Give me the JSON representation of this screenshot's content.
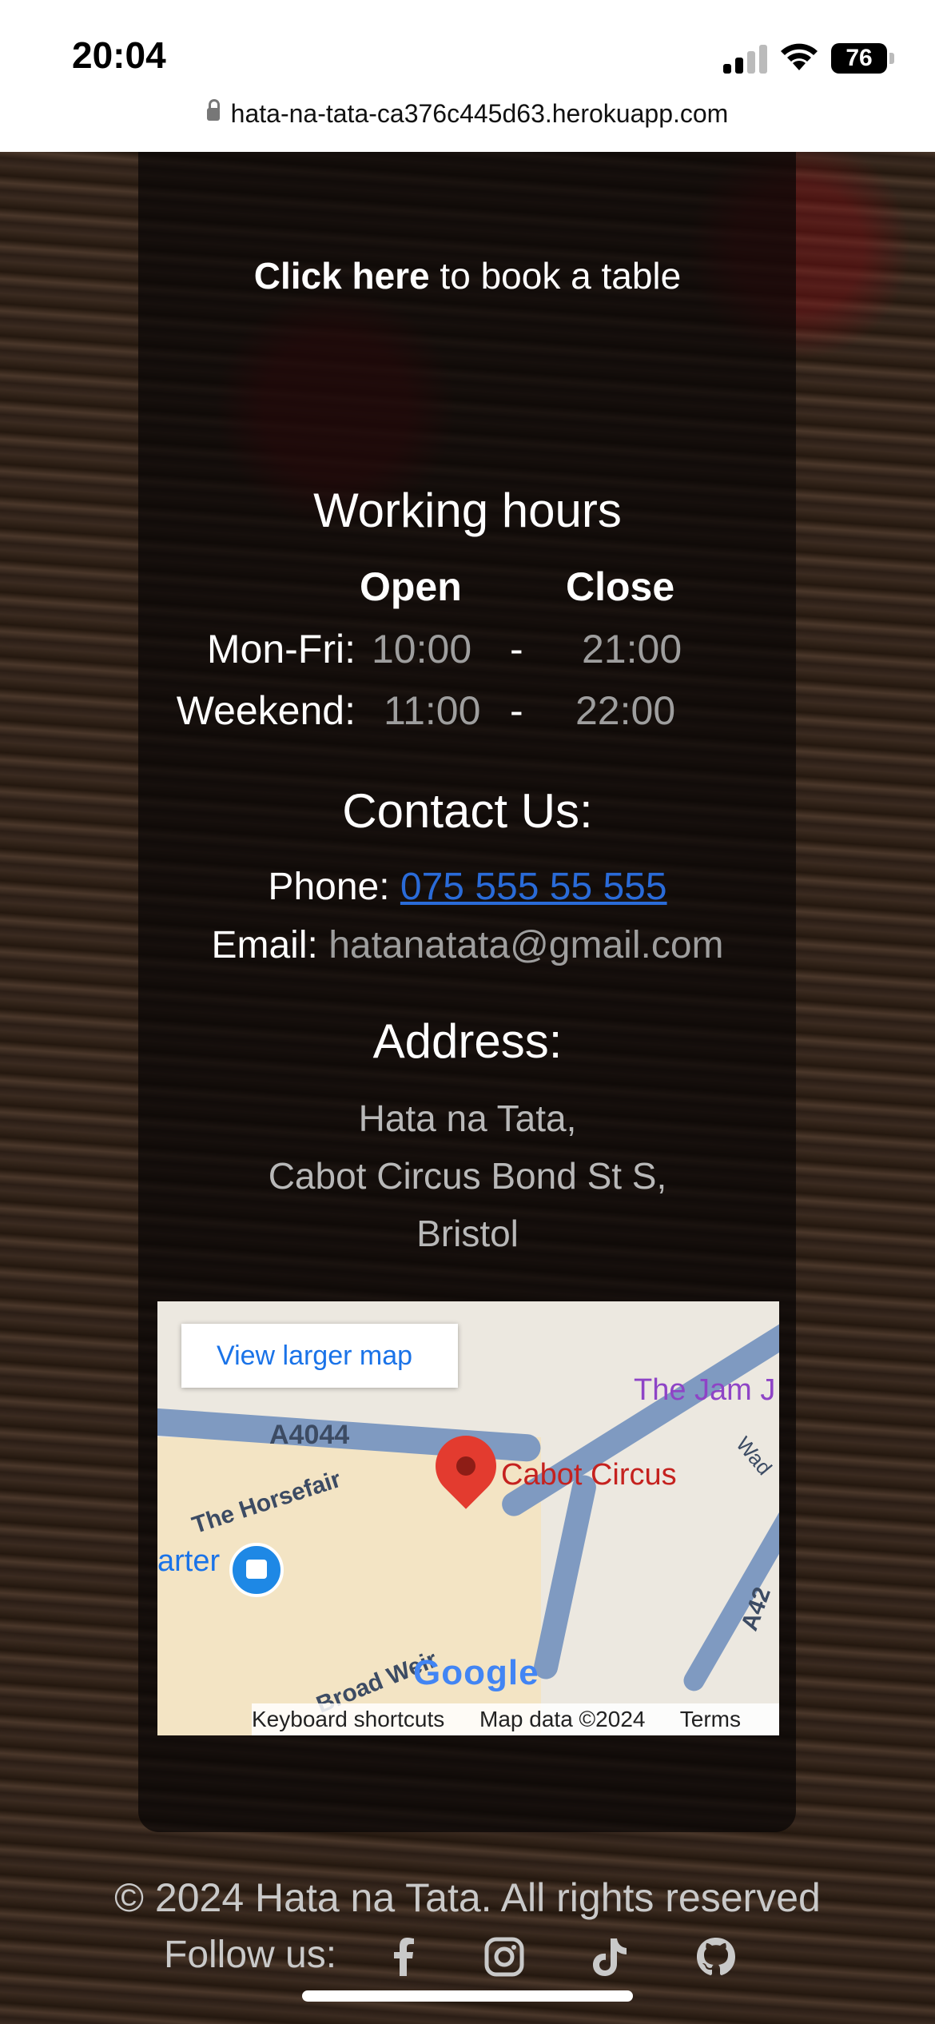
{
  "status": {
    "time": "20:04",
    "battery": "76",
    "url": "hata-na-tata-ca376c445d63.herokuapp.com"
  },
  "booking": {
    "link_text": "Click here",
    "rest_text": " to book a table"
  },
  "hours": {
    "title": "Working hours",
    "open_label": "Open",
    "close_label": "Close",
    "rows": [
      {
        "day": "Mon-Fri:",
        "open": "10:00",
        "dash": "-",
        "close": "21:00"
      },
      {
        "day": "Weekend:",
        "open": "11:00",
        "dash": "-",
        "close": "22:00"
      }
    ]
  },
  "contact": {
    "title": "Contact Us:",
    "phone_label": "Phone:",
    "phone": "075 555 55 555",
    "email_label": "Email:",
    "email": "hatanatata@gmail.com"
  },
  "address": {
    "title": "Address:",
    "lines": [
      "Hata na Tata,",
      "Cabot Circus Bond St S,",
      "Bristol"
    ]
  },
  "map": {
    "button": "View larger map",
    "labels": {
      "road_a4044": "A4044",
      "horsefair": "The Horsefair",
      "place": "Cabot Circus",
      "jam": "The Jam J",
      "quarter": "arter",
      "broad_weir": "Broad Weir",
      "a42": "A42",
      "wad": "Wad"
    },
    "brand": "Google",
    "footer": {
      "shortcuts": "Keyboard shortcuts",
      "data": "Map data ©2024",
      "terms": "Terms"
    }
  },
  "footer": {
    "copyright": "© 2024 Hata na Tata. All rights reserved",
    "follow": "Follow us:"
  }
}
